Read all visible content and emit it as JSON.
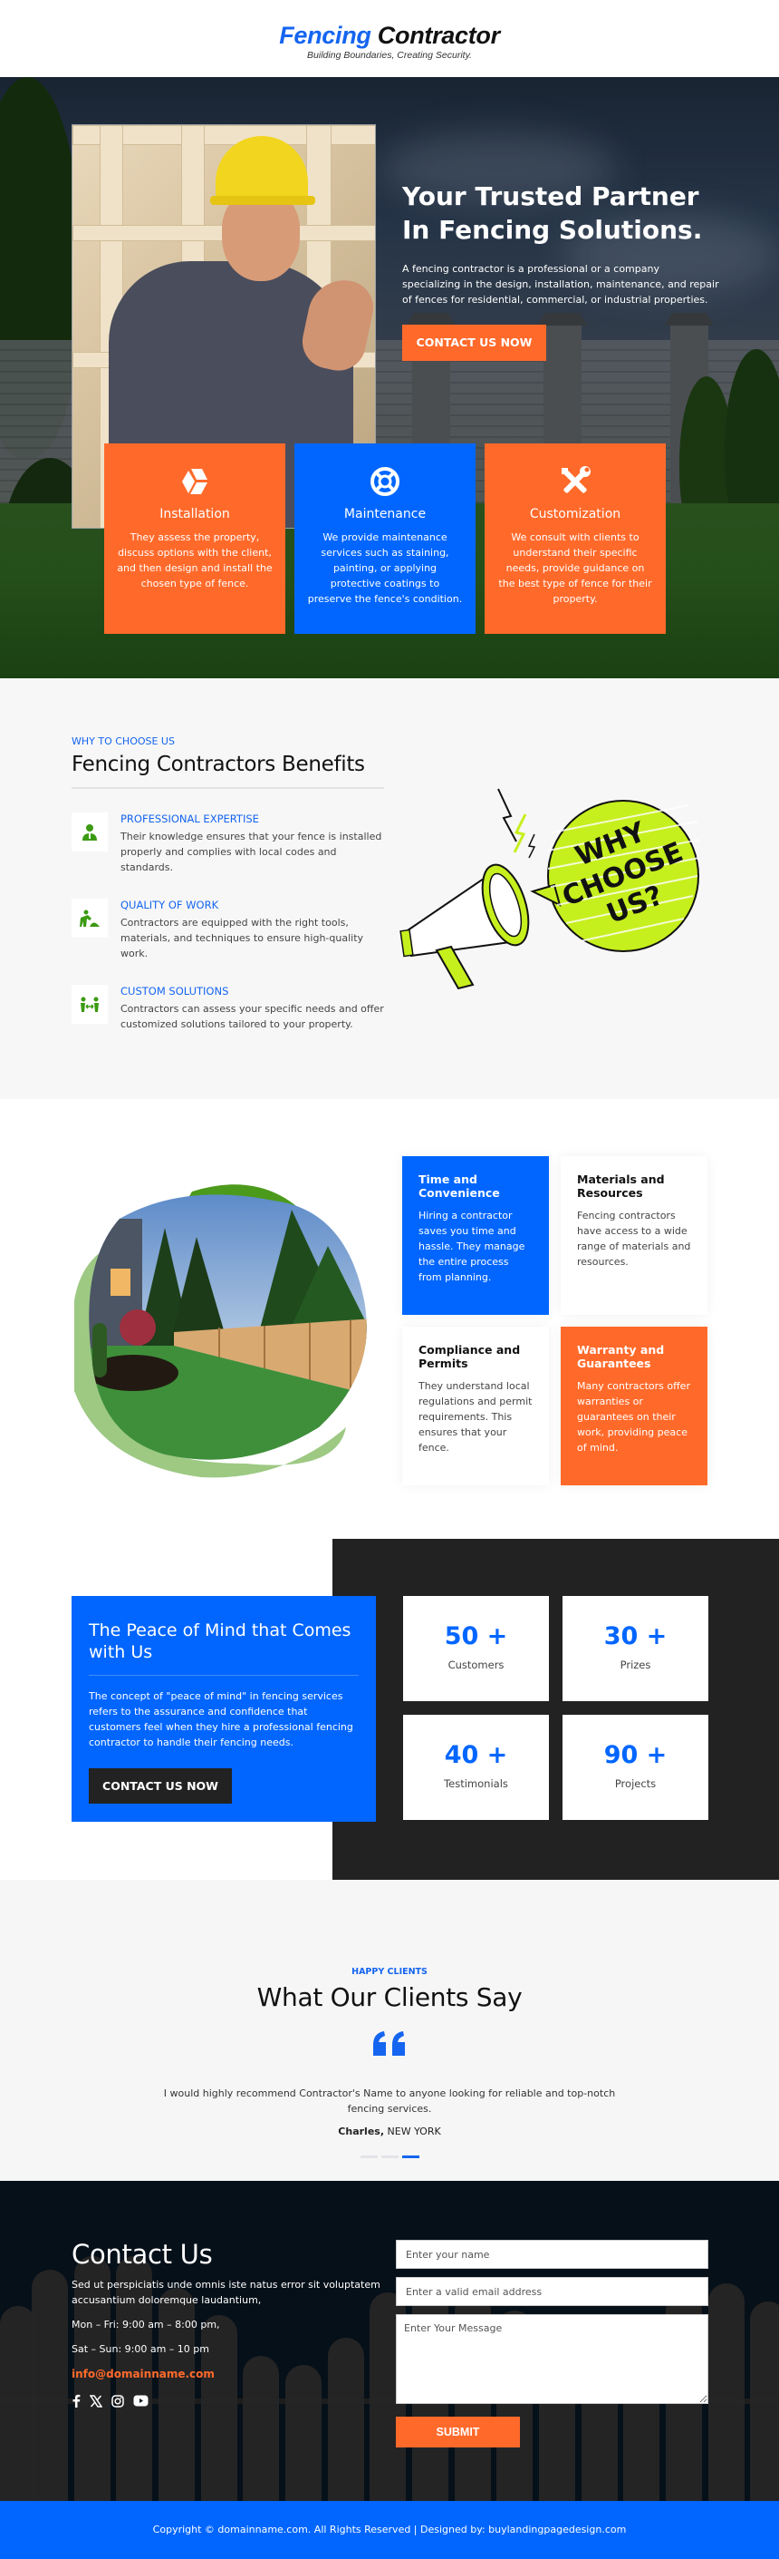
{
  "brand": {
    "name_part1": "Fencing",
    "name_part2": "Contractor",
    "tagline": "Building Boundaries, Creating Security.",
    "colors": {
      "blue": "#0066ff",
      "orange": "#ff6a2b",
      "dark": "#222222",
      "navy": "#061019",
      "light_bg": "#f7f7f7"
    }
  },
  "hero": {
    "title_line1": "Your Trusted Partner",
    "title_line2": "In Fencing Solutions.",
    "description": "A fencing contractor is a professional or a company specializing in the design, installation, maintenance, and repair of fences for residential, commercial, or industrial properties.",
    "cta_label": "CONTACT US NOW",
    "services": [
      {
        "icon": "cube-icon",
        "title": "Installation",
        "text": "They assess the property, discuss options with the client, and then design and install the chosen type of fence."
      },
      {
        "icon": "lifebuoy-icon",
        "title": "Maintenance",
        "text": "We provide maintenance services such as staining, painting, or applying protective coatings to preserve the fence's condition."
      },
      {
        "icon": "tools-icon",
        "title": "Customization",
        "text": "We consult with clients to understand their specific needs, provide guidance on the best type of fence for their property."
      }
    ]
  },
  "benefits": {
    "kicker": "WHY TO CHOOSE US",
    "heading": "Fencing Contractors Benefits",
    "items": [
      {
        "icon": "expert-person-icon",
        "title": "PROFESSIONAL EXPERTISE",
        "text": "Their knowledge ensures that your fence is installed properly and complies with local codes and standards."
      },
      {
        "icon": "worker-digging-icon",
        "title": "QUALITY OF WORK",
        "text": "Contractors are equipped with the right tools, materials, and techniques to ensure high-quality work."
      },
      {
        "icon": "people-exchange-icon",
        "title": "CUSTOM SOLUTIONS",
        "text": "Contractors can assess your specific needs and offer customized solutions tailored to your property."
      }
    ],
    "graphic": {
      "line1": "WHY",
      "line2": "CHOOSE",
      "line3": "US?"
    }
  },
  "features": {
    "cards": [
      {
        "title": "Time and Convenience",
        "text": "Hiring a contractor saves you time and hassle. They manage the entire process from planning.",
        "style": "blue"
      },
      {
        "title": "Materials and Resources",
        "text": "Fencing contractors have access to a wide range of materials and resources.",
        "style": "white"
      },
      {
        "title": "Compliance and Permits",
        "text": "They understand local regulations and permit requirements. This ensures that your fence.",
        "style": "white"
      },
      {
        "title": "Warranty and Guarantees",
        "text": "Many contractors offer warranties or guarantees on their work, providing peace of mind.",
        "style": "orange"
      }
    ]
  },
  "peace": {
    "heading": "The Peace of Mind that Comes with Us",
    "text": "The concept of \"peace of mind\" in fencing services refers to the assurance and confidence that customers feel when they hire a professional fencing contractor to handle their fencing needs.",
    "cta_label": "CONTACT US NOW",
    "stats": [
      {
        "value": "50 +",
        "label": "Customers"
      },
      {
        "value": "30 +",
        "label": "Prizes"
      },
      {
        "value": "40 +",
        "label": "Testimonials"
      },
      {
        "value": "90 +",
        "label": "Projects"
      }
    ]
  },
  "testimonials": {
    "kicker": "HAPPY CLIENTS",
    "heading": "What Our Clients Say",
    "quote": "I would highly recommend Contractor's Name to anyone looking for reliable and top-notch fencing services.",
    "author_name": "Charles,",
    "author_location": "NEW YORK",
    "slides_total": 3,
    "active_slide": 3
  },
  "contact": {
    "heading": "Contact Us",
    "text": "Sed ut perspiciatis unde omnis iste natus error sit voluptatem accusantium doloremque laudantium,",
    "hours_weekday": "Mon – Fri: 9:00 am – 8:00 pm,",
    "hours_weekend": "Sat – Sun: 9:00 am – 10 pm",
    "email": "info@domainname.com",
    "socials": [
      "facebook-icon",
      "x-twitter-icon",
      "instagram-icon",
      "youtube-icon"
    ],
    "form": {
      "name_placeholder": "Enter your name",
      "name_value": "",
      "email_placeholder": "Enter a valid email address",
      "email_value": "",
      "message_placeholder": "Enter Your Message",
      "message_value": "",
      "submit_label": "SUBMIT"
    }
  },
  "footer": {
    "text": "Copyright © domainname.com. All Rights Reserved | Designed by: buylandingpagedesign.com"
  }
}
